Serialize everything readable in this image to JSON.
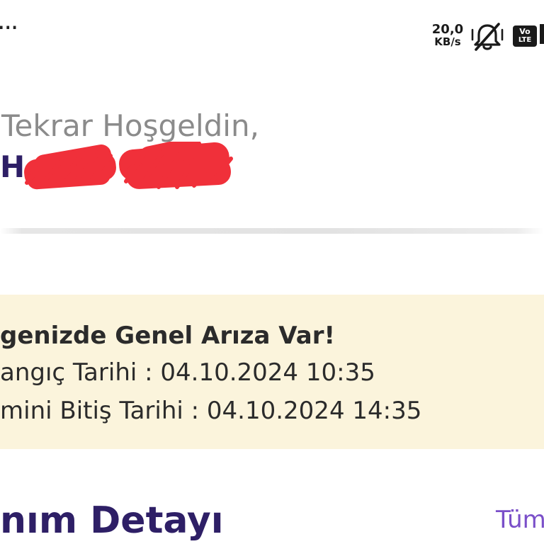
{
  "status_bar": {
    "overflow_dots": "...",
    "net_speed_value": "20,0",
    "net_speed_unit": "KB/s",
    "icons": [
      "bell-muted-icon",
      "volte-icon"
    ],
    "volte_top": "Vo",
    "volte_bottom": "LTE"
  },
  "greeting": {
    "line": "Tekrar Hoşgeldin,",
    "name_initial": "H."
  },
  "alert": {
    "title": "genizde Genel Arıza Var!",
    "start_line": "angıç Tarihi : 04.10.2024 10:35",
    "end_line": "mini Bitiş Tarihi : 04.10.2024 14:35",
    "background_color": "#fbf4dc"
  },
  "section": {
    "title": "nım Detayı",
    "see_all": "Tüm"
  },
  "colors": {
    "brand_dark": "#2e1f66",
    "link": "#7a4fc9",
    "redaction": "#f0303a"
  }
}
